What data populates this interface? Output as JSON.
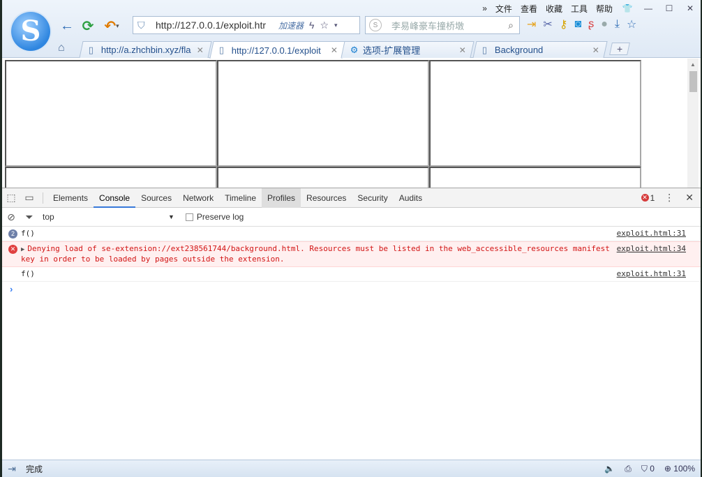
{
  "browser": {
    "menu": [
      "文件",
      "查看",
      "收藏",
      "工具",
      "帮助"
    ],
    "address": {
      "url": "http://127.0.0.1/exploit.htr",
      "accelerator": "加速器"
    },
    "search": {
      "placeholder": "李易峰豪车撞桥墩"
    },
    "tabs": [
      {
        "label": "http://a.zhchbin.xyz/fla",
        "active": false
      },
      {
        "label": "http://127.0.0.1/exploit",
        "active": true
      },
      {
        "label": "选项-扩展管理",
        "active": false
      },
      {
        "label": "Background",
        "active": false
      }
    ],
    "new_tab": "+"
  },
  "devtools": {
    "tabs": [
      "Elements",
      "Console",
      "Sources",
      "Network",
      "Timeline",
      "Profiles",
      "Resources",
      "Security",
      "Audits"
    ],
    "selected_tab": "Console",
    "error_count": "1",
    "context": "top",
    "preserve_log": "Preserve log",
    "console": [
      {
        "type": "log",
        "count": "2",
        "text": "f()",
        "source": "exploit.html:31"
      },
      {
        "type": "error",
        "text": "Denying load of se-extension://ext238561744/background.html. Resources must be listed in the web_accessible_resources manifest key in order to be loaded by pages outside the extension.",
        "source": "exploit.html:34"
      },
      {
        "type": "log",
        "text": "f()",
        "source": "exploit.html:31"
      }
    ],
    "prompt": "›"
  },
  "status_bar": {
    "text": "完成",
    "security_count": "0",
    "zoom": "100%"
  },
  "colors": {
    "accent": "#3879d9",
    "error": "#d21414",
    "chrome": "#dfe9f5"
  }
}
